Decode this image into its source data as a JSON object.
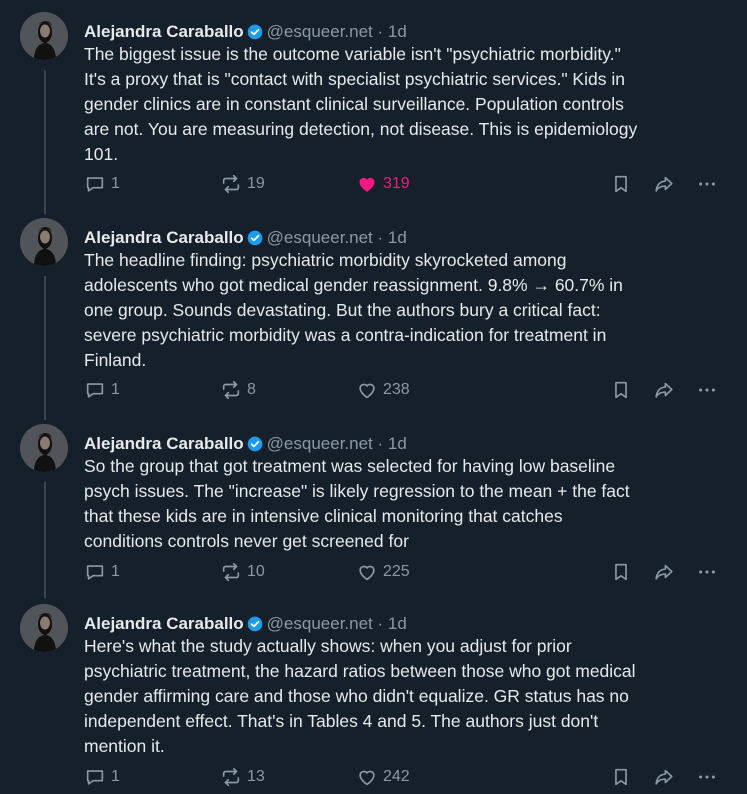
{
  "posts": [
    {
      "author": "Alejandra Caraballo",
      "handle": "@esqueer.net",
      "sep": "·",
      "time": "1d",
      "text": "The biggest issue is the outcome variable isn't \"psychiatric morbidity.\"\nIt's a proxy that is \"contact with specialist psychiatric services.\" Kids in\ngender clinics are in constant clinical surveillance. Population controls\nare not. You are measuring detection, not disease. This is epidemiology\n101.",
      "replies": "1",
      "reposts": "19",
      "likes": "319",
      "liked": true
    },
    {
      "author": "Alejandra Caraballo",
      "handle": "@esqueer.net",
      "sep": "·",
      "time": "1d",
      "text": "The headline finding: psychiatric morbidity skyrocketed among\nadolescents who got medical gender reassignment. 9.8% → 60.7% in\none group. Sounds devastating. But the authors bury a critical fact:\nsevere psychiatric morbidity was a contra-indication for treatment in\nFinland.",
      "replies": "1",
      "reposts": "8",
      "likes": "238",
      "liked": false
    },
    {
      "author": "Alejandra Caraballo",
      "handle": "@esqueer.net",
      "sep": "·",
      "time": "1d",
      "text": "So the group that got treatment was selected for having low baseline\npsych issues. The \"increase\" is likely regression to the mean + the fact\nthat these kids are in intensive clinical monitoring that catches\nconditions controls never get screened for",
      "replies": "1",
      "reposts": "10",
      "likes": "225",
      "liked": false
    },
    {
      "author": "Alejandra Caraballo",
      "handle": "@esqueer.net",
      "sep": "·",
      "time": "1d",
      "text": "Here's what the study actually shows: when you adjust for prior\npsychiatric treatment, the hazard ratios between those who got medical\ngender affirming care and those who didn't equalize. GR status has no\nindependent effect. That's in Tables 4 and 5. The authors just don't\nmention it.",
      "replies": "1",
      "reposts": "13",
      "likes": "242",
      "liked": false
    }
  ],
  "icons": {
    "reply": "reply-icon",
    "repost": "repost-icon",
    "like": "heart-icon",
    "bookmark": "bookmark-icon",
    "share": "share-icon",
    "more": "more-icon",
    "verified": "verified-badge-icon"
  },
  "colors": {
    "background": "#15202b",
    "text": "#e7e9ea",
    "muted": "#8b98a5",
    "like": "#f91880",
    "verified": "#1d9bf0"
  }
}
